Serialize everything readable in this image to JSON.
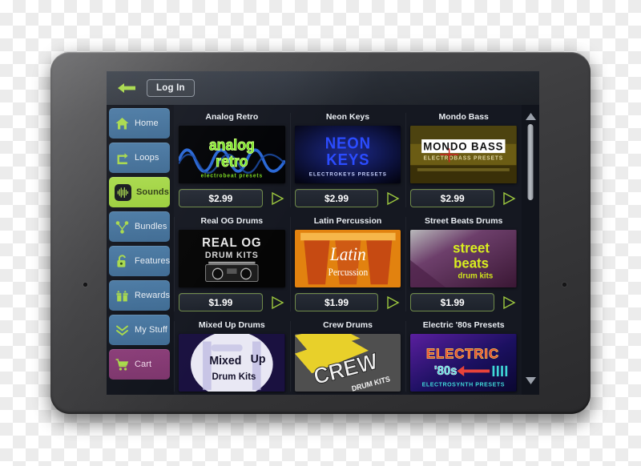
{
  "device": {
    "name": "tablet-device",
    "orientation": "landscape"
  },
  "app": {
    "topbar": {
      "back_label": "back-arrow",
      "login_label": "Log In"
    },
    "sidebar": {
      "items": [
        {
          "label": "Home",
          "icon": "home-icon",
          "state": "normal"
        },
        {
          "label": "Loops",
          "icon": "loop-icon",
          "state": "normal"
        },
        {
          "label": "Sounds",
          "icon": "waveform-icon",
          "state": "active"
        },
        {
          "label": "Bundles",
          "icon": "bundles-icon",
          "state": "normal"
        },
        {
          "label": "Features",
          "icon": "unlock-icon",
          "state": "normal"
        },
        {
          "label": "Rewards",
          "icon": "gift-icon",
          "state": "normal"
        },
        {
          "label": "My Stuff",
          "icon": "chevrons-down-icon",
          "state": "normal"
        },
        {
          "label": "Cart",
          "icon": "cart-icon",
          "state": "cart"
        }
      ]
    },
    "grid": {
      "play_icon": "play-triangle-icon",
      "items": [
        {
          "title": "Analog Retro",
          "price": "$2.99",
          "art": "analog-retro"
        },
        {
          "title": "Neon Keys",
          "price": "$2.99",
          "art": "neon-keys"
        },
        {
          "title": "Mondo Bass",
          "price": "$2.99",
          "art": "mondo-bass"
        },
        {
          "title": "Real OG Drums",
          "price": "$1.99",
          "art": "real-og-drums"
        },
        {
          "title": "Latin Percussion",
          "price": "$1.99",
          "art": "latin-percussion"
        },
        {
          "title": "Street Beats Drums",
          "price": "$1.99",
          "art": "street-beats"
        },
        {
          "title": "Mixed Up Drums",
          "price": "",
          "art": "mixed-up-drums"
        },
        {
          "title": "Crew Drums",
          "price": "",
          "art": "crew-drums"
        },
        {
          "title": "Electric '80s Presets",
          "price": "",
          "art": "electric-80s"
        }
      ]
    },
    "scrollbar": {
      "up_icon": "triangle-up-icon",
      "down_icon": "triangle-down-icon"
    },
    "colors": {
      "accent_green": "#a8d94b",
      "sidebar_blue": "#41709a",
      "cart_purple": "#82376f",
      "screen_bg": "#151821",
      "topbar": "#2e343e"
    },
    "art_text": {
      "analog_retro": {
        "l1": "analog",
        "l2": "retro",
        "l3": "electrobeat presets"
      },
      "neon_keys": {
        "l1": "NEON",
        "l2": "KEYS",
        "l3": "ELECTROKEYS PRESETS"
      },
      "mondo_bass": {
        "l1": "MONDO BASS",
        "l2": "ELECTROBASS PRESETS"
      },
      "real_og": {
        "l1": "REAL OG",
        "l2": "DRUM KITS"
      },
      "latin": {
        "l1": "Latin",
        "l2": "Percussion"
      },
      "street_beats": {
        "l1": "street",
        "l2": "beats",
        "l3": "drum kits"
      },
      "mixed_up": {
        "l1": "Mixed",
        "l2": "Up",
        "l3": "Drum Kits"
      },
      "crew": {
        "l1": "CREW",
        "l2": "DRUM KITS"
      },
      "electric80s": {
        "l1": "ELECTRIC",
        "l2": "'80s",
        "l3": "ELECTROSYNTH PRESETS"
      }
    }
  }
}
